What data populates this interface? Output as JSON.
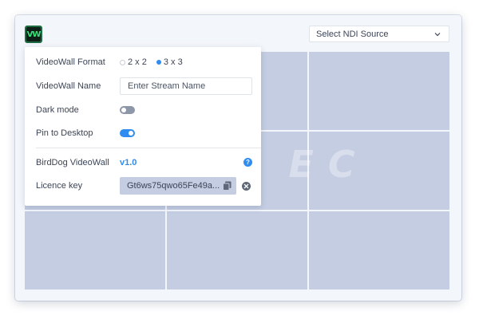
{
  "app": {
    "logo_text": "VW"
  },
  "header": {
    "ndi_source_placeholder": "Select NDI Source"
  },
  "watermark": {
    "text": "PEL EC"
  },
  "settings": {
    "format_label": "VideoWall Format",
    "format_options": [
      {
        "label": "2 x 2",
        "selected": false
      },
      {
        "label": "3 x 3",
        "selected": true
      }
    ],
    "name_label": "VideoWall Name",
    "name_placeholder": "Enter Stream Name",
    "name_value": "",
    "dark_mode_label": "Dark mode",
    "dark_mode_on": false,
    "pin_label": "Pin to Desktop",
    "pin_on": true,
    "product_label": "BirdDog VideoWall",
    "version": "v1.0",
    "help_icon_text": "?",
    "licence_label": "Licence key",
    "licence_value": "Gt6ws75qwo65Fe49a..."
  },
  "icons": {
    "logo": "videowall-logo-icon",
    "select": "chevron-down-icon",
    "help": "help-icon",
    "copy": "copy-icon",
    "clear": "clear-icon"
  },
  "colors": {
    "accent": "#2f8cf0",
    "tile": "#c4cde2",
    "logo_green": "#39e07a",
    "toggle_off": "#8e97a8"
  }
}
